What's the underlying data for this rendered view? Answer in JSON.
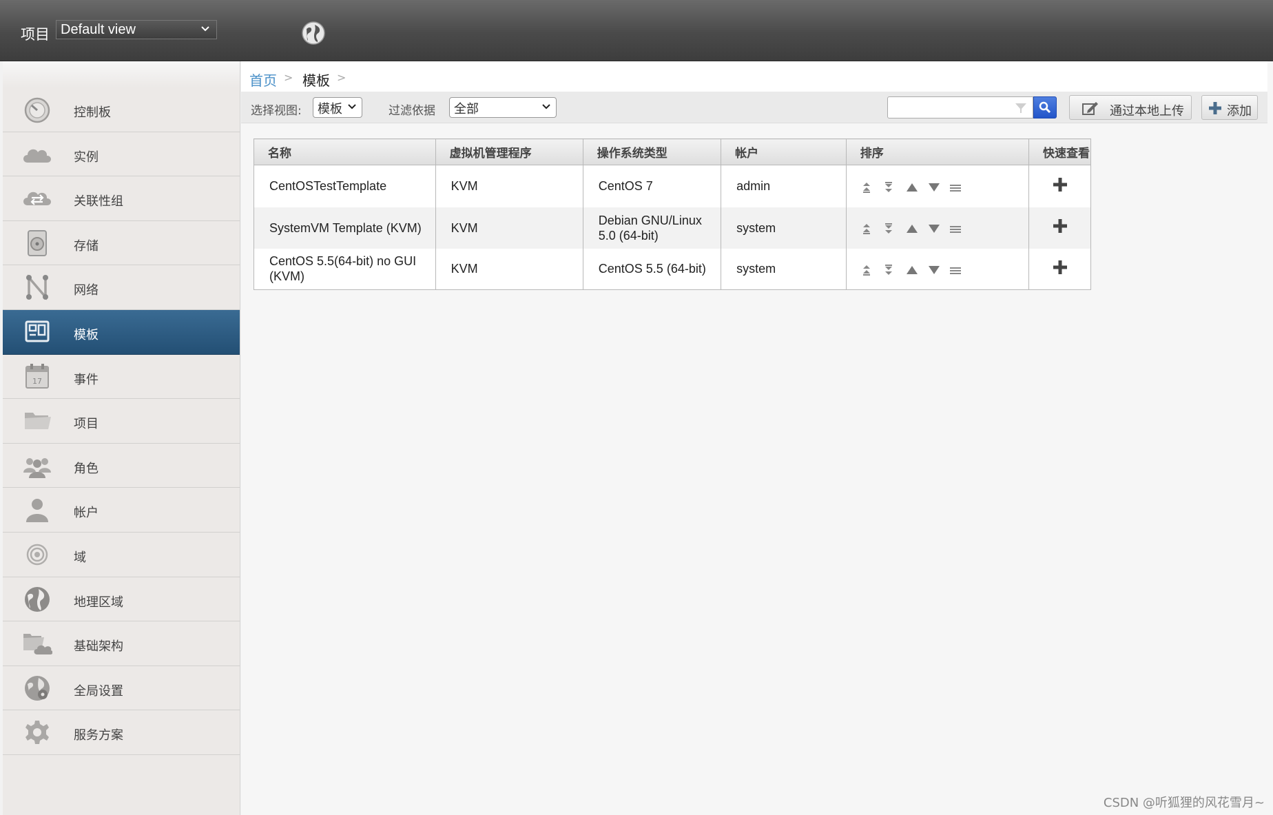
{
  "header": {
    "project_label": "项目",
    "project_view": "Default view",
    "globe_icon": "globe-icon"
  },
  "sidebar": {
    "items": [
      {
        "label": "控制板",
        "icon": "dashboard-icon"
      },
      {
        "label": "实例",
        "icon": "cloud-icon"
      },
      {
        "label": "关联性组",
        "icon": "affinity-icon"
      },
      {
        "label": "存储",
        "icon": "storage-icon"
      },
      {
        "label": "网络",
        "icon": "network-icon"
      },
      {
        "label": "模板",
        "icon": "template-icon",
        "active": true
      },
      {
        "label": "事件",
        "icon": "calendar-icon"
      },
      {
        "label": "项目",
        "icon": "folder-icon"
      },
      {
        "label": "角色",
        "icon": "roles-icon"
      },
      {
        "label": "帐户",
        "icon": "user-icon"
      },
      {
        "label": "域",
        "icon": "domain-icon"
      },
      {
        "label": "地理区域",
        "icon": "globe-icon"
      },
      {
        "label": "基础架构",
        "icon": "infrastructure-icon"
      },
      {
        "label": "全局设置",
        "icon": "global-settings-icon"
      },
      {
        "label": "服务方案",
        "icon": "gear-icon"
      }
    ],
    "active_color": "#2a5a82"
  },
  "breadcrumb": {
    "home": "首页",
    "sep": ">",
    "current": "模板"
  },
  "toolbar": {
    "select_view_label": "选择视图:",
    "select_view_value": "模板",
    "filter_label": "过滤依据",
    "filter_value": "全部",
    "search_placeholder": "",
    "upload_label": "通过本地上传",
    "add_label": "添加"
  },
  "table": {
    "columns": [
      "名称",
      "虚拟机管理程序",
      "操作系统类型",
      "帐户",
      "排序",
      "快速查看"
    ],
    "rows": [
      {
        "name": "CentOSTestTemplate",
        "hypervisor": "KVM",
        "os": "CentOS 7",
        "account": "admin"
      },
      {
        "name": "SystemVM Template (KVM)",
        "hypervisor": "KVM",
        "os": "Debian GNU/Linux 5.0 (64-bit)",
        "account": "system"
      },
      {
        "name": "CentOS 5.5(64-bit) no GUI (KVM)",
        "hypervisor": "KVM",
        "os": "CentOS 5.5 (64-bit)",
        "account": "system"
      }
    ]
  },
  "watermark": "CSDN @听狐狸的风花雪月~"
}
